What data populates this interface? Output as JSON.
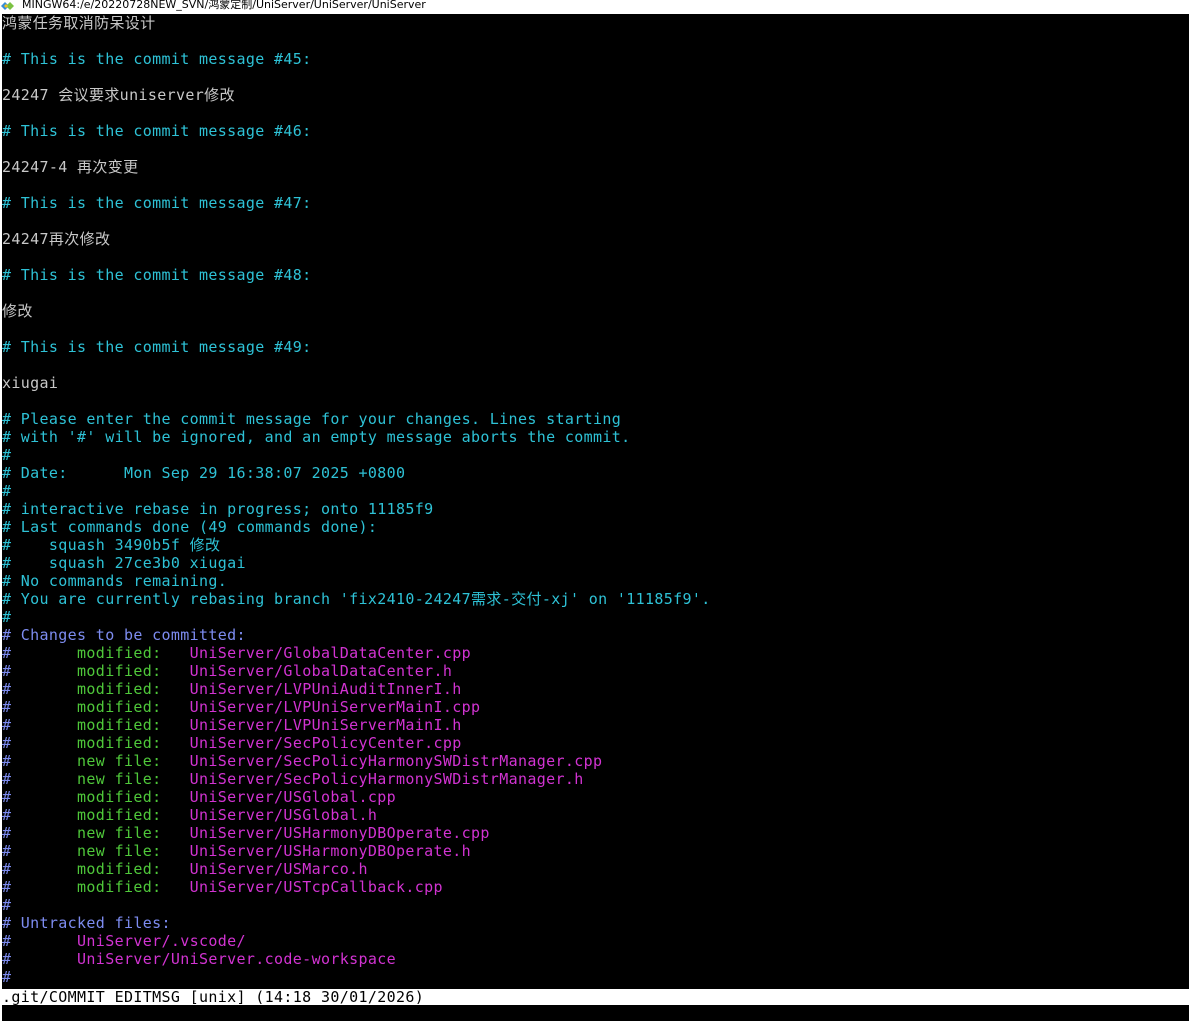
{
  "window": {
    "title": "MINGW64:/e/20220728NEW_SVN/鸿蒙定制/UniServer/UniServer/UniServer",
    "icon": "mingw-terminal-icon"
  },
  "editor": {
    "lines": [
      {
        "text": "鸿蒙任务取消防呆设计",
        "color": "white"
      },
      {
        "text": "",
        "color": "white"
      },
      {
        "text": "# This is the commit message #45:",
        "color": "cyan"
      },
      {
        "text": "",
        "color": "white"
      },
      {
        "text": "24247 会议要求uniserver修改",
        "color": "white"
      },
      {
        "text": "",
        "color": "white"
      },
      {
        "text": "# This is the commit message #46:",
        "color": "cyan"
      },
      {
        "text": "",
        "color": "white"
      },
      {
        "text": "24247-4 再次变更",
        "color": "white"
      },
      {
        "text": "",
        "color": "white"
      },
      {
        "text": "# This is the commit message #47:",
        "color": "cyan"
      },
      {
        "text": "",
        "color": "white"
      },
      {
        "text": "24247再次修改",
        "color": "white"
      },
      {
        "text": "",
        "color": "white"
      },
      {
        "text": "# This is the commit message #48:",
        "color": "cyan"
      },
      {
        "text": "",
        "color": "white"
      },
      {
        "text": "修改",
        "color": "white"
      },
      {
        "text": "",
        "color": "white"
      },
      {
        "text": "# This is the commit message #49:",
        "color": "cyan"
      },
      {
        "text": "",
        "color": "white"
      },
      {
        "text": "xiugai",
        "color": "white"
      },
      {
        "text": "",
        "color": "white"
      },
      {
        "text": "# Please enter the commit message for your changes. Lines starting",
        "color": "cyan"
      },
      {
        "text": "# with '#' will be ignored, and an empty message aborts the commit.",
        "color": "cyan"
      },
      {
        "text": "#",
        "color": "cyan"
      },
      {
        "text": "# Date:      Mon Sep 29 16:38:07 2025 +0800",
        "color": "cyan"
      },
      {
        "text": "#",
        "color": "cyan"
      },
      {
        "text": "# interactive rebase in progress; onto 11185f9",
        "color": "cyan"
      },
      {
        "text": "# Last commands done (49 commands done):",
        "color": "cyan"
      },
      {
        "text": "#    squash 3490b5f 修改",
        "color": "cyan"
      },
      {
        "text": "#    squash 27ce3b0 xiugai",
        "color": "cyan"
      },
      {
        "text": "# No commands remaining.",
        "color": "cyan"
      },
      {
        "text": "# You are currently rebasing branch 'fix2410-24247需求-交付-xj' on '11185f9'.",
        "color": "cyan"
      },
      {
        "text": "#",
        "color": "cyan"
      },
      {
        "text": "# Changes to be committed:",
        "color": "blue"
      },
      {
        "prefix": "#",
        "status": "modified:",
        "file": "UniServer/GlobalDataCenter.cpp"
      },
      {
        "prefix": "#",
        "status": "modified:",
        "file": "UniServer/GlobalDataCenter.h"
      },
      {
        "prefix": "#",
        "status": "modified:",
        "file": "UniServer/LVPUniAuditInnerI.h"
      },
      {
        "prefix": "#",
        "status": "modified:",
        "file": "UniServer/LVPUniServerMainI.cpp"
      },
      {
        "prefix": "#",
        "status": "modified:",
        "file": "UniServer/LVPUniServerMainI.h"
      },
      {
        "prefix": "#",
        "status": "modified:",
        "file": "UniServer/SecPolicyCenter.cpp"
      },
      {
        "prefix": "#",
        "status": "new file:",
        "file": "UniServer/SecPolicyHarmonySWDistrManager.cpp"
      },
      {
        "prefix": "#",
        "status": "new file:",
        "file": "UniServer/SecPolicyHarmonySWDistrManager.h"
      },
      {
        "prefix": "#",
        "status": "modified:",
        "file": "UniServer/USGlobal.cpp"
      },
      {
        "prefix": "#",
        "status": "modified:",
        "file": "UniServer/USGlobal.h"
      },
      {
        "prefix": "#",
        "status": "new file:",
        "file": "UniServer/USHarmonyDBOperate.cpp"
      },
      {
        "prefix": "#",
        "status": "new file:",
        "file": "UniServer/USHarmonyDBOperate.h"
      },
      {
        "prefix": "#",
        "status": "modified:",
        "file": "UniServer/USMarco.h"
      },
      {
        "prefix": "#",
        "status": "modified:",
        "file": "UniServer/USTcpCallback.cpp"
      },
      {
        "text": "#",
        "color": "blue"
      },
      {
        "text": "# Untracked files:",
        "color": "blue"
      },
      {
        "prefix": "#",
        "untracked": "UniServer/.vscode/"
      },
      {
        "prefix": "#",
        "untracked": "UniServer/UniServer.code-workspace"
      },
      {
        "text": "#",
        "color": "blue"
      }
    ]
  },
  "statusbar": {
    "text": ".git/COMMIT_EDITMSG [unix] (14:18 30/01/2026)"
  },
  "colors": {
    "background": "#000000",
    "cyan": "#2ec2d6",
    "blue": "#7d8cf0",
    "green": "#4fc83a",
    "magenta": "#d233d2",
    "white": "#c8c8c8"
  }
}
